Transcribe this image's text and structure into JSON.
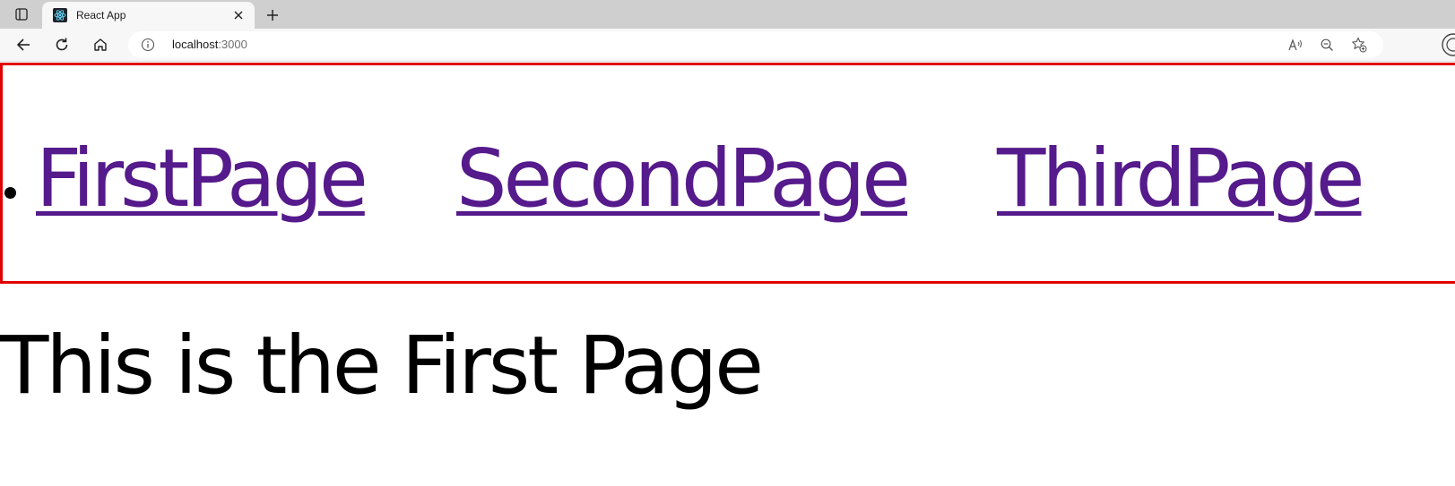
{
  "browser": {
    "tab": {
      "title": "React App",
      "close_symbol": "✕"
    },
    "new_tab_symbol": "+",
    "address": {
      "host": "localhost",
      "port": ":3000"
    }
  },
  "nav": {
    "links": [
      {
        "label": "FirstPage"
      },
      {
        "label": "SecondPage"
      },
      {
        "label": "ThirdPage"
      }
    ],
    "link_color": "#551a8b",
    "border_color": "#e00000"
  },
  "main": {
    "heading": "This is the First Page"
  }
}
